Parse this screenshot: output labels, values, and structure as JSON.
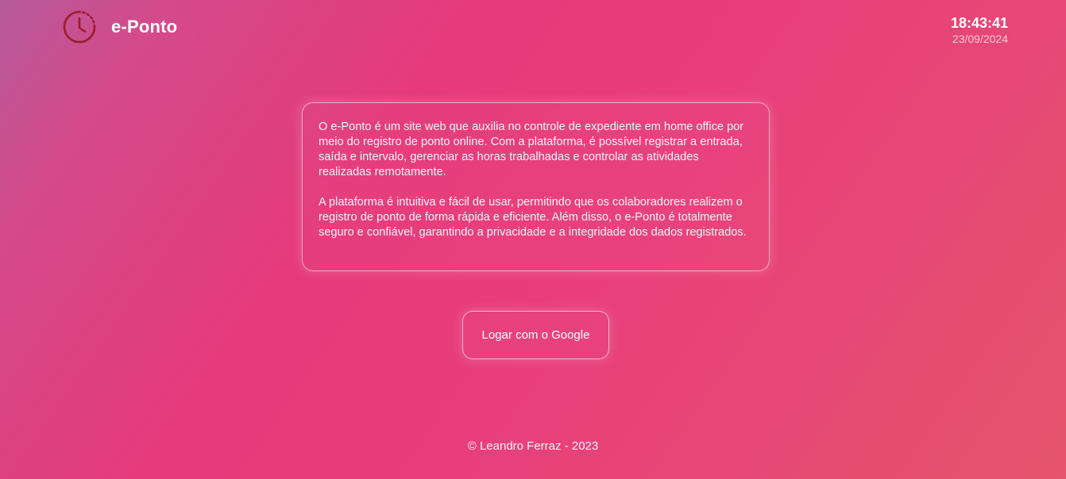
{
  "header": {
    "brand_name": "e-Ponto",
    "brand_icon": "clock-icon",
    "time": "18:43:41",
    "date": "23/09/2024"
  },
  "about": {
    "paragraph_1": "O e-Ponto é um site web que auxilia no controle de expediente em home office por meio do registro de ponto online. Com a plataforma, é possível registrar a entrada, saída e intervalo, gerenciar as horas trabalhadas e controlar as atividades realizadas remotamente.",
    "paragraph_2": "A plataforma é intuitiva e fácil de usar, permitindo que os colaboradores realizem o registro de ponto de forma rápida e eficiente. Além disso, o e-Ponto é totalmente seguro e confiável, garantindo a privacidade e a integridade dos dados registrados."
  },
  "login": {
    "google_label": "Logar com o Google"
  },
  "footer": {
    "copyright": "© Leandro Ferraz - 2023"
  },
  "colors": {
    "icon_red": "#9b1c2c",
    "gradient_start": "#b55a9a",
    "gradient_mid": "#e63a7a",
    "gradient_end": "#e5556c"
  }
}
